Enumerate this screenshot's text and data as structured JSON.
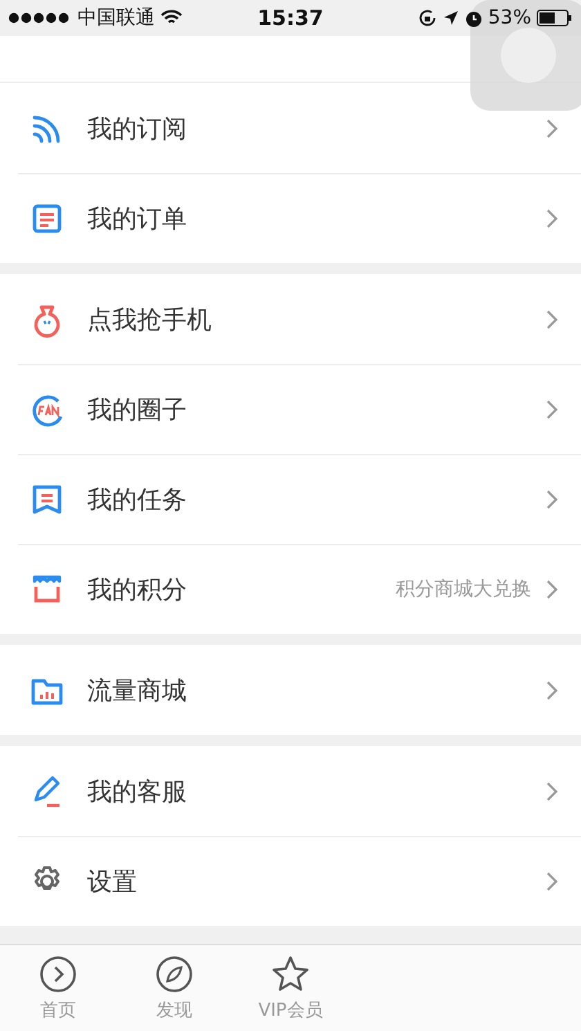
{
  "status_bar": {
    "carrier": "中国联通",
    "time": "15:37",
    "battery": "53%"
  },
  "groups": [
    {
      "items": [
        {
          "label": "我的订阅"
        },
        {
          "label": "我的订单"
        }
      ]
    },
    {
      "items": [
        {
          "label": "点我抢手机"
        },
        {
          "label": "我的圈子"
        },
        {
          "label": "我的任务"
        },
        {
          "label": "我的积分",
          "detail": "积分商城大兑换"
        }
      ]
    },
    {
      "items": [
        {
          "label": "流量商城"
        }
      ]
    },
    {
      "items": [
        {
          "label": "我的客服"
        },
        {
          "label": "设置"
        }
      ]
    }
  ],
  "tab_bar": [
    {
      "label": "首页"
    },
    {
      "label": "发现"
    },
    {
      "label": "VIP会员"
    }
  ]
}
